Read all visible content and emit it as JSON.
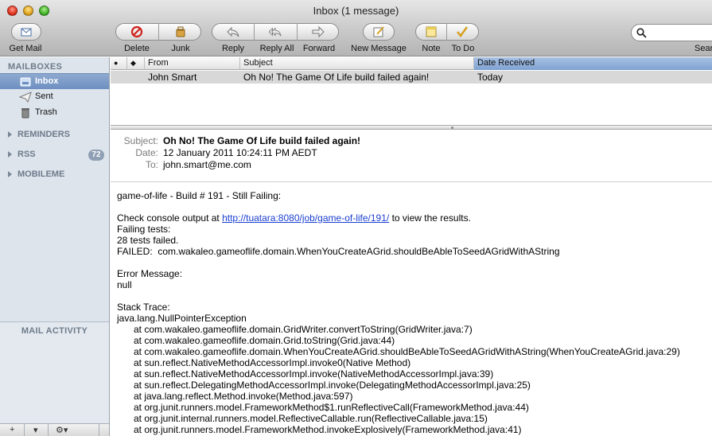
{
  "window": {
    "title": "Inbox (1 message)"
  },
  "toolbar": {
    "get_mail": "Get Mail",
    "delete": "Delete",
    "junk": "Junk",
    "reply": "Reply",
    "reply_all": "Reply All",
    "forward": "Forward",
    "new_message": "New Message",
    "note": "Note",
    "todo": "To Do",
    "search": "Sear"
  },
  "sidebar": {
    "mailboxes_header": "MAILBOXES",
    "items": [
      {
        "label": "Inbox",
        "icon": "inbox-icon"
      },
      {
        "label": "Sent",
        "icon": "sent-icon"
      },
      {
        "label": "Trash",
        "icon": "trash-icon"
      }
    ],
    "groups": [
      {
        "label": "REMINDERS"
      },
      {
        "label": "RSS",
        "badge": "72"
      },
      {
        "label": "MOBILEME"
      }
    ],
    "mail_activity": "MAIL ACTIVITY",
    "bottom": {
      "add": "+",
      "dropdown": "▾",
      "gear": "⚙▾"
    }
  },
  "message_list": {
    "columns": {
      "read": "●",
      "flag": "◆",
      "from": "From",
      "subject": "Subject",
      "date": "Date Received"
    },
    "rows": [
      {
        "from": "John Smart",
        "subject": "Oh No! The Game Of Life build failed again!",
        "date": "Today"
      }
    ]
  },
  "message": {
    "subject_label": "Subject:",
    "subject": "Oh No! The Game Of Life build failed again!",
    "date_label": "Date:",
    "date": "12 January 2011 10:24:11 PM AEDT",
    "to_label": "To:",
    "to": "john.smart@me.com",
    "body": {
      "line1": "game-of-life - Build # 191 - Still Failing:",
      "console_prefix": "Check console output at ",
      "console_link": "http://tuatara:8080/job/game-of-life/191/",
      "console_suffix": " to view the results.",
      "failing_tests": "Failing tests:",
      "tests_failed": "28 tests failed.",
      "failed": "FAILED:  com.wakaleo.gameoflife.domain.WhenYouCreateAGrid.shouldBeAbleToSeedAGridWithAString",
      "error_message": "Error Message:",
      "null": "null",
      "stack_trace": "Stack Trace:",
      "exception": "java.lang.NullPointerException",
      "frames": [
        "at com.wakaleo.gameoflife.domain.GridWriter.convertToString(GridWriter.java:7)",
        "at com.wakaleo.gameoflife.domain.Grid.toString(Grid.java:44)",
        "at com.wakaleo.gameoflife.domain.WhenYouCreateAGrid.shouldBeAbleToSeedAGridWithAString(WhenYouCreateAGrid.java:29)",
        "at sun.reflect.NativeMethodAccessorImpl.invoke0(Native Method)",
        "at sun.reflect.NativeMethodAccessorImpl.invoke(NativeMethodAccessorImpl.java:39)",
        "at sun.reflect.DelegatingMethodAccessorImpl.invoke(DelegatingMethodAccessorImpl.java:25)",
        "at java.lang.reflect.Method.invoke(Method.java:597)",
        "at org.junit.runners.model.FrameworkMethod$1.runReflectiveCall(FrameworkMethod.java:44)",
        "at org.junit.internal.runners.model.ReflectiveCallable.run(ReflectiveCallable.java:15)",
        "at org.junit.runners.model.FrameworkMethod.invokeExplosively(FrameworkMethod.java:41)"
      ]
    }
  },
  "colors": {
    "link": "#1a3fd0",
    "sidebar_bg": "#dde4ec",
    "selection": "#6d8fc0",
    "sorted_column": "#7fa2d2",
    "row_highlight": "#d8d8d8"
  }
}
